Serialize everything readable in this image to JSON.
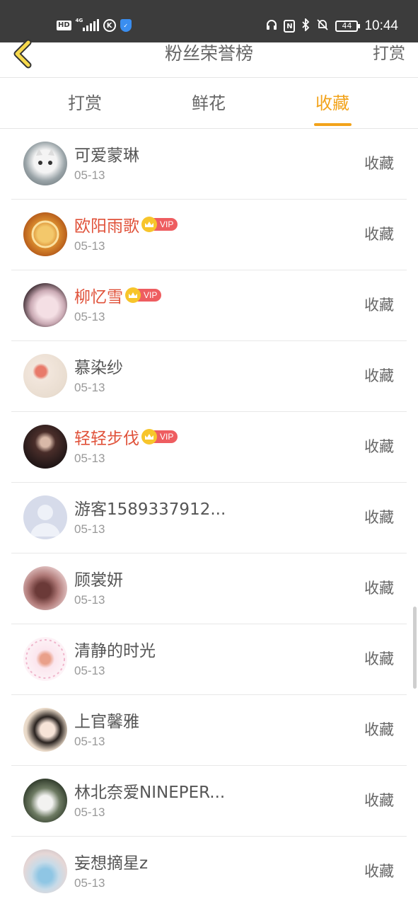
{
  "status_bar": {
    "hd": "HD",
    "network": "4G",
    "k_icon": "K",
    "battery": "44",
    "time": "10:44"
  },
  "header": {
    "title": "粉丝荣誉榜",
    "right_link": "打赏"
  },
  "tabs": [
    {
      "label": "打赏",
      "active": false
    },
    {
      "label": "鲜花",
      "active": false
    },
    {
      "label": "收藏",
      "active": true
    }
  ],
  "colors": {
    "accent": "#f2a31b",
    "vip_name": "#e0523a",
    "vip_tag": "#ee5d60",
    "vip_crown": "#f7c52b"
  },
  "vip_label": "VIP",
  "fans": [
    {
      "name": "可爱蒙琳",
      "date": "05-13",
      "vip": false,
      "action": "收藏",
      "avatar": "kitten-avatar"
    },
    {
      "name": "欧阳雨歌",
      "date": "05-13",
      "vip": true,
      "action": "收藏",
      "avatar": "pie-avatar"
    },
    {
      "name": "柳忆雪",
      "date": "05-13",
      "vip": true,
      "action": "收藏",
      "avatar": "girl-avatar"
    },
    {
      "name": "慕染纱",
      "date": "05-13",
      "vip": false,
      "action": "收藏",
      "avatar": "fruit-avatar"
    },
    {
      "name": "轻轻步伐",
      "date": "05-13",
      "vip": true,
      "action": "收藏",
      "avatar": "dark-portrait-avatar"
    },
    {
      "name": "游客1589337912...",
      "date": "05-13",
      "vip": false,
      "action": "收藏",
      "avatar": "default-user-avatar"
    },
    {
      "name": "顾裳妍",
      "date": "05-13",
      "vip": false,
      "action": "收藏",
      "avatar": "heart-avatar"
    },
    {
      "name": "清静的时光",
      "date": "05-13",
      "vip": false,
      "action": "收藏",
      "avatar": "cartoon-avatar"
    },
    {
      "name": "上官馨雅",
      "date": "05-13",
      "vip": false,
      "action": "收藏",
      "avatar": "flower-girl-avatar"
    },
    {
      "name": "林北奈爱NINEPER...",
      "date": "05-13",
      "vip": false,
      "action": "收藏",
      "avatar": "white-dress-avatar"
    },
    {
      "name": "妄想摘星z",
      "date": "05-13",
      "vip": false,
      "action": "收藏",
      "avatar": "blue-girl-avatar"
    }
  ]
}
